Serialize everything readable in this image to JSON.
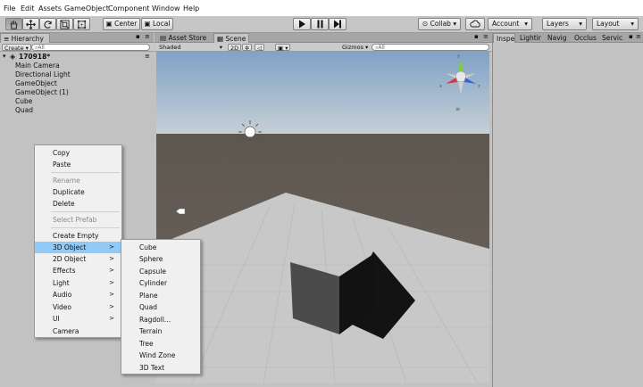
{
  "menu": [
    "File",
    "Edit",
    "Assets",
    "GameObject",
    "Component",
    "Window",
    "Help"
  ],
  "toolbar": {
    "pivot_label": "Center",
    "space_label": "Local",
    "collab_label": "Collab",
    "account_label": "Account",
    "layers_label": "Layers",
    "layout_label": "Layout"
  },
  "hierarchy": {
    "tab_label": "Hierarchy",
    "create_label": "Create",
    "search_placeholder": "All",
    "scene_name": "170918*",
    "items": [
      "Main Camera",
      "Directional Light",
      "GameObject",
      "GameObject (1)",
      "Cube",
      "Quad"
    ]
  },
  "center_tabs": [
    "Asset Store",
    "Scene"
  ],
  "scene_bar": {
    "shading": "Shaded",
    "mode_2d": "2D",
    "gizmos": "Gizmos",
    "search_placeholder": "All"
  },
  "right_tabs": [
    "Inspe",
    "Lightir",
    "Navig",
    "Occlus",
    "Servic"
  ],
  "context_menu": [
    {
      "label": "Copy",
      "state": "normal"
    },
    {
      "label": "Paste",
      "state": "normal"
    },
    {
      "label": "Rename",
      "state": "disabled"
    },
    {
      "label": "Duplicate",
      "state": "normal"
    },
    {
      "label": "Delete",
      "state": "normal"
    },
    {
      "label": "Select Prefab",
      "state": "disabled"
    },
    {
      "label": "Create Empty",
      "state": "normal"
    },
    {
      "label": "3D Object",
      "state": "highlighted",
      "submenu": true
    },
    {
      "label": "2D Object",
      "state": "normal",
      "submenu": true
    },
    {
      "label": "Effects",
      "state": "normal",
      "submenu": true
    },
    {
      "label": "Light",
      "state": "normal",
      "submenu": true
    },
    {
      "label": "Audio",
      "state": "normal",
      "submenu": true
    },
    {
      "label": "Video",
      "state": "normal",
      "submenu": true
    },
    {
      "label": "UI",
      "state": "normal",
      "submenu": true
    },
    {
      "label": "Camera",
      "state": "normal"
    }
  ],
  "submenu_arrow": ">",
  "submenu_3d": [
    "Cube",
    "Sphere",
    "Capsule",
    "Cylinder",
    "Plane",
    "Quad",
    "Ragdoll...",
    "Terrain",
    "Tree",
    "Wind Zone",
    "3D Text"
  ],
  "icons": [
    "hand-icon",
    "move-icon",
    "rotate-icon",
    "scale-icon",
    "rect-icon",
    "play-icon",
    "pause-icon",
    "step-icon",
    "cloud-icon",
    "sun-icon",
    "light-toggle-icon",
    "image-icon",
    "lock-icon",
    "panel-menu-icon"
  ]
}
